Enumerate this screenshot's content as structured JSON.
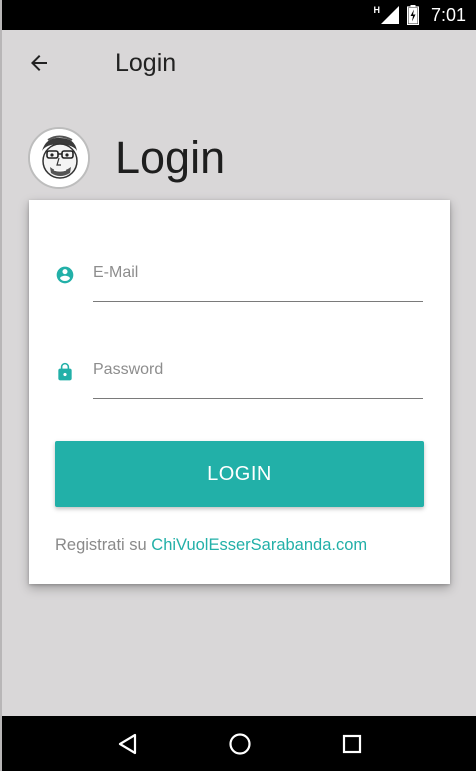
{
  "status_bar": {
    "network_label": "H",
    "time": "7:01",
    "icons": [
      "signal-icon",
      "battery-icon"
    ]
  },
  "app_bar": {
    "back_icon": "arrow-left-icon",
    "title": "Login"
  },
  "header": {
    "avatar_icon": "caricature-avatar",
    "title": "Login"
  },
  "form": {
    "email": {
      "icon": "account-circle-icon",
      "placeholder": "E-Mail",
      "value": ""
    },
    "password": {
      "icon": "lock-icon",
      "placeholder": "Password",
      "value": ""
    },
    "login_button": "LOGIN",
    "register_prefix": "Registrati su ",
    "register_link": "ChiVuolEsserSarabanda.com"
  },
  "nav_bar": {
    "icons": [
      "back-triangle-icon",
      "home-circle-icon",
      "recents-square-icon"
    ]
  },
  "colors": {
    "accent": "#22b0a8",
    "background": "#d9d7d8",
    "card": "#ffffff",
    "status_bar": "#000000"
  }
}
